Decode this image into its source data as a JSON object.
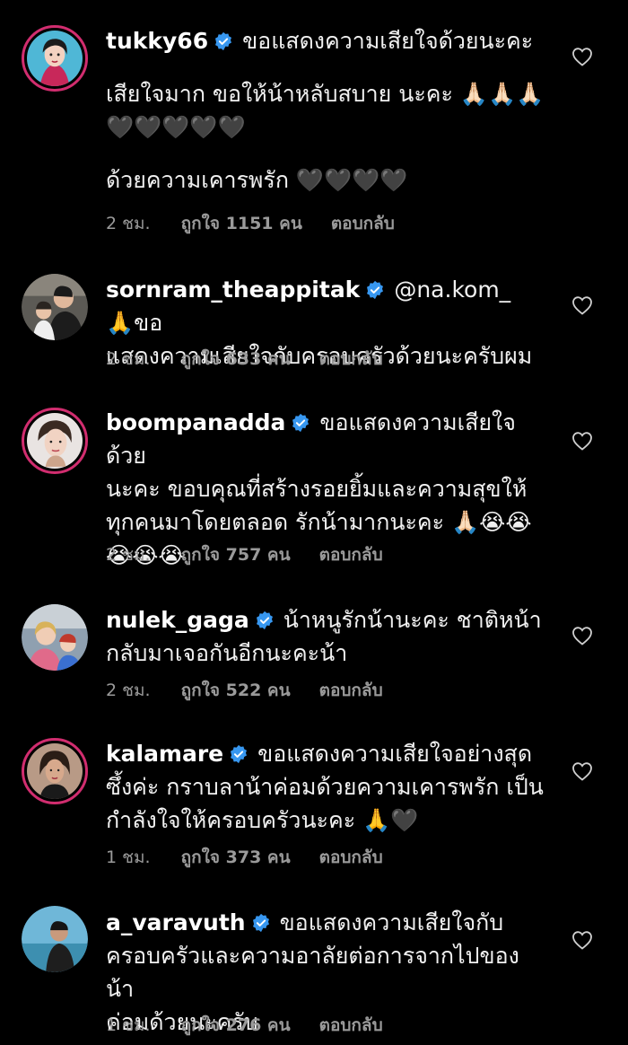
{
  "comments": [
    {
      "username": "tukky66",
      "lines": [
        "ขอแสดงความเสียใจด้วยนะคะ"
      ],
      "extra": [
        "เสียใจมาก ขอให้น้าหลับสบาย นะคะ 🙏🏻🙏🏻🙏🏻",
        "🖤🖤🖤🖤🖤"
      ],
      "extra2": [
        "ด้วยความเคารพรัก 🖤🖤🖤🖤"
      ],
      "time": "2 ชม.",
      "likes": "ถูกใจ 1151 คน",
      "reply": "ตอบกลับ"
    },
    {
      "username": "sornram_theappitak",
      "first": "@na.kom_ 🙏ขอ",
      "lines": [
        "แสดงความเสียใจกับครอบครัวด้วยนะครับผม"
      ],
      "time": "2 ชม.",
      "likes": "ถูกใจ 633 คน",
      "reply": "ตอบกลับ"
    },
    {
      "username": "boompanadda",
      "first": "ขอแสดงความเสียใจด้วย",
      "lines": [
        "นะคะ ขอบคุณที่สร้างรอยยิ้มและความสุขให้",
        "ทุกคนมาโดยตลอด รักน้ามากนะคะ 🙏🏻😭😭",
        "😭😭😭"
      ],
      "time": "2 ชม.",
      "likes": "ถูกใจ 757 คน",
      "reply": "ตอบกลับ"
    },
    {
      "username": "nulek_gaga",
      "first": "น้าหนูรักน้านะคะ ชาติหน้า",
      "lines": [
        "กลับมาเจอกันอีกนะคะน้า"
      ],
      "time": "2 ชม.",
      "likes": "ถูกใจ 522 คน",
      "reply": "ตอบกลับ"
    },
    {
      "username": "kalamare",
      "first": "ขอแสดงความเสียใจอย่างสุด",
      "lines": [
        "ซึ้งค่ะ กราบลาน้าค่อมด้วยความเคารพรัก เป็น",
        "กำลังใจให้ครอบครัวนะคะ 🙏🖤"
      ],
      "time": "1 ชม.",
      "likes": "ถูกใจ 373 คน",
      "reply": "ตอบกลับ"
    },
    {
      "username": "a_varavuth",
      "first": "ขอแสดงความเสียใจกับ",
      "lines": [
        "ครอบครัวและความอาลัยต่อการจากไปของน้า",
        "ค่อมด้วยนะครับ"
      ],
      "time": "1 ชม.",
      "likes": "ถูกใจ 276 คน",
      "reply": "ตอบกลับ"
    }
  ],
  "icons": {
    "verified": "verified-badge-icon",
    "like": "heart-outline-icon"
  },
  "colors": {
    "background": "#000000",
    "verified": "#3797f0",
    "story_ring": "#d12d6f",
    "meta": "#9a9a9a"
  }
}
